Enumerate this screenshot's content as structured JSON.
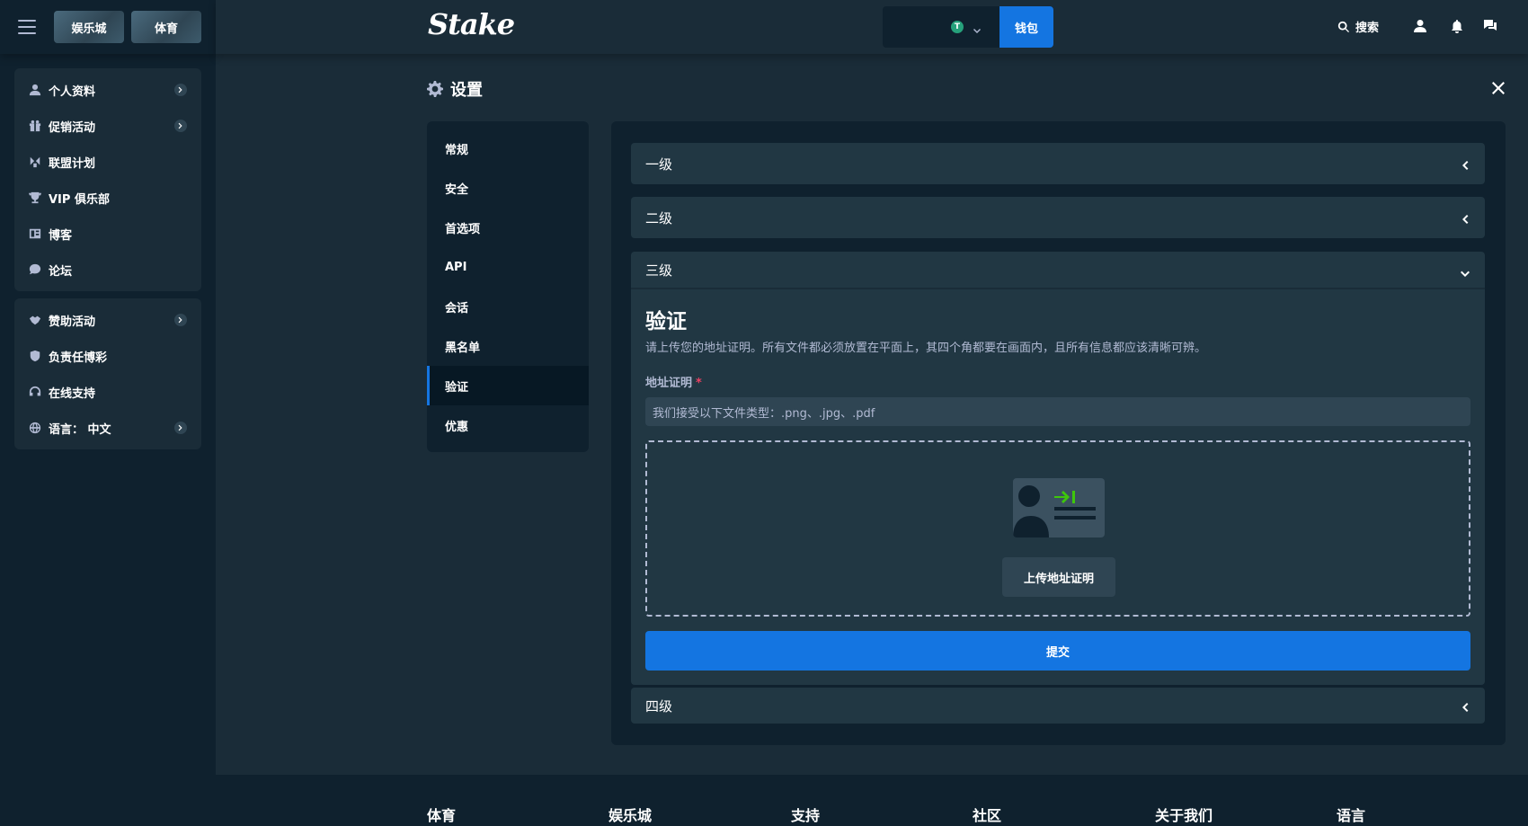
{
  "colors": {
    "bg": "#1a2c38",
    "sidebar": "#0f212e",
    "accent": "#1475e1",
    "muted": "#b1bad3",
    "required": "#ed4163",
    "card_green": "#3ec70b"
  },
  "top_tabs": [
    "娱乐城",
    "体育"
  ],
  "sidebar": {
    "group1": [
      {
        "label": "个人资料",
        "icon": "user-icon",
        "has_chevron": true
      },
      {
        "label": "促销活动",
        "icon": "gift-icon",
        "has_chevron": true
      },
      {
        "label": "联盟计划",
        "icon": "affiliate-icon",
        "has_chevron": false
      },
      {
        "label": "VIP 俱乐部",
        "icon": "trophy-icon",
        "has_chevron": false
      },
      {
        "label": "博客",
        "icon": "blog-icon",
        "has_chevron": false
      },
      {
        "label": "论坛",
        "icon": "forum-icon",
        "has_chevron": false
      }
    ],
    "group2": [
      {
        "label": "赞助活动",
        "icon": "handshake-icon",
        "has_chevron": true
      },
      {
        "label": "负责任博彩",
        "icon": "shield-icon",
        "has_chevron": false
      },
      {
        "label": "在线支持",
        "icon": "headset-icon",
        "has_chevron": false
      },
      {
        "label": "语言：  中文",
        "icon": "globe-icon",
        "has_chevron": true
      }
    ]
  },
  "header": {
    "logo": "Stake",
    "currency_symbol": "T",
    "wallet_label": "钱包",
    "search_label": "搜索"
  },
  "settings": {
    "title": "设置",
    "nav": [
      "常规",
      "安全",
      "首选项",
      "API",
      "会话",
      "黑名单",
      "验证",
      "优惠"
    ],
    "active_nav": "验证"
  },
  "levels": {
    "level1": "一级",
    "level2": "二级",
    "level3": "三级",
    "level4": "四级"
  },
  "verification": {
    "title": "验证",
    "description": "请上传您的地址证明。所有文件都必须放置在平面上，其四个角都要在画面内，且所有信息都应该清晰可辨。",
    "field_label": "地址证明",
    "required_mark": "*",
    "file_hint": "我们接受以下文件类型：.png、.jpg、.pdf",
    "upload_button": "上传地址证明",
    "submit_button": "提交"
  },
  "footer": [
    "体育",
    "娱乐城",
    "支持",
    "社区",
    "关于我们",
    "语言"
  ]
}
